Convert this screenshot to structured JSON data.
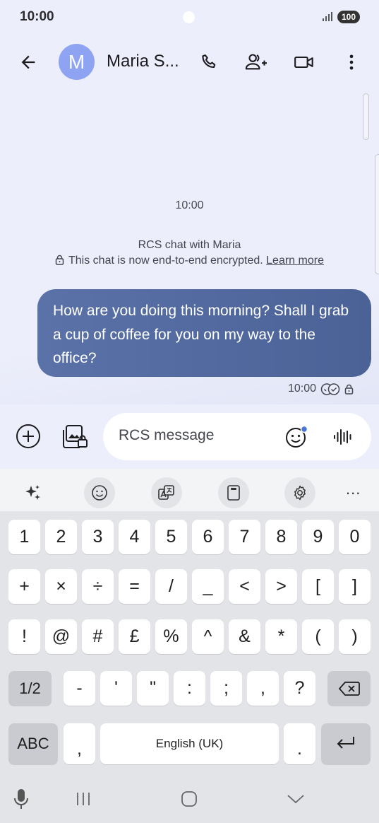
{
  "status": {
    "time": "10:00",
    "battery": "100"
  },
  "header": {
    "avatar_letter": "M",
    "contact_name": "Maria S..."
  },
  "thread": {
    "timestamp": "10:00",
    "rcs_title": "RCS chat with Maria",
    "rcs_encrypted": "This chat is now end-to-end encrypted.",
    "learn_more": "Learn more",
    "messages": [
      {
        "text": "How are you doing this morning? Shall I grab a cup of coffee for you on my way to the office?",
        "time": "10:00"
      }
    ]
  },
  "composer": {
    "placeholder": "RCS message",
    "value": ""
  },
  "keyboard": {
    "row1": [
      "1",
      "2",
      "3",
      "4",
      "5",
      "6",
      "7",
      "8",
      "9",
      "0"
    ],
    "row2": [
      "+",
      "×",
      "÷",
      "=",
      "/",
      "_",
      "<",
      ">",
      "[",
      "]"
    ],
    "row3": [
      "!",
      "@",
      "#",
      "£",
      "%",
      "^",
      "&",
      "*",
      "(",
      ")"
    ],
    "row4": [
      "-",
      "'",
      "\"",
      ":",
      ";",
      ",",
      "?"
    ],
    "shift_label": "1/2",
    "abc_label": "ABC",
    "comma": ",",
    "space_label": "English (UK)",
    "period": ".",
    "more_label": "..."
  },
  "colors": {
    "accent": "#4a6296",
    "avatar": "#8ea4f3",
    "background": "#eceefb"
  }
}
